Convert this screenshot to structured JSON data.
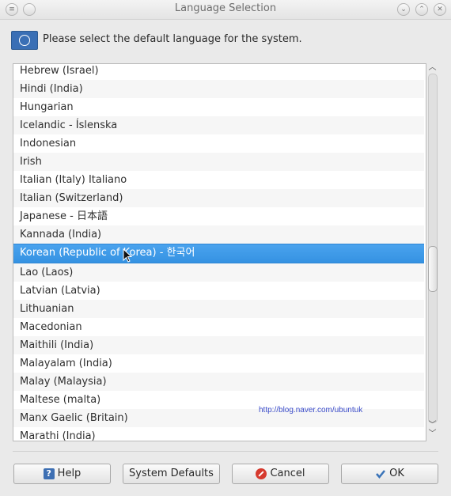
{
  "window": {
    "title": "Language Selection",
    "menu_glyph": "≡",
    "min_glyph": "⌄",
    "max_glyph": "⌃",
    "close_glyph": "✕"
  },
  "header": {
    "message": "Please select the default language for the system."
  },
  "languages": [
    "Hebrew (Israel)",
    "Hindi (India)",
    "Hungarian",
    "Icelandic - Íslenska",
    "Indonesian",
    "Irish",
    "Italian (Italy) Italiano",
    "Italian (Switzerland)",
    "Japanese - 日本語",
    "Kannada (India)",
    "Korean (Republic of Korea) - 한국어",
    "Lao (Laos)",
    "Latvian (Latvia)",
    "Lithuanian",
    "Macedonian",
    "Maithili (India)",
    "Malayalam (India)",
    "Malay (Malaysia)",
    "Maltese (malta)",
    "Manx Gaelic (Britain)",
    "Marathi (India)"
  ],
  "selected_index": 10,
  "watermark": "http://blog.naver.com/ubuntuk",
  "buttons": {
    "help": "Help",
    "system_defaults": "System Defaults",
    "cancel": "Cancel",
    "ok": "OK"
  },
  "colors": {
    "selection": "#3592e2",
    "watermark": "#3b4cc9"
  }
}
